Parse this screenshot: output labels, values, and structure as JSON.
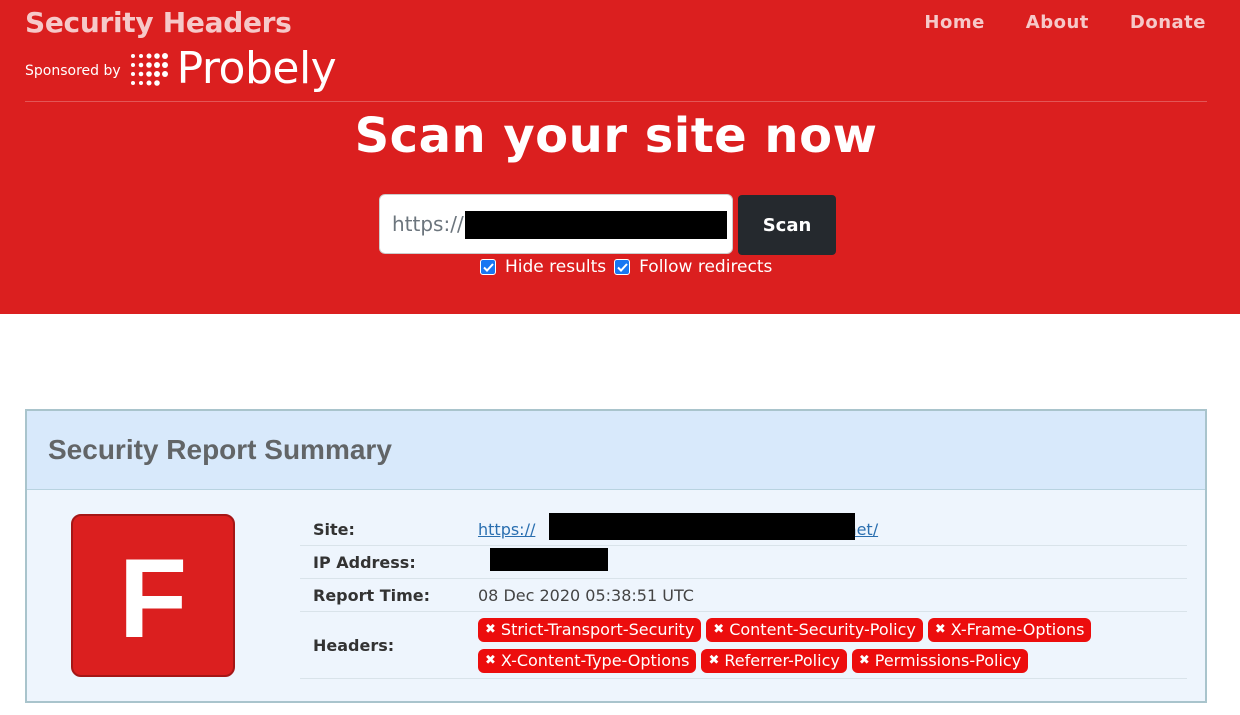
{
  "header": {
    "brand_title": "Security Headers",
    "sponsor_label": "Sponsored by",
    "sponsor_name": "Probely",
    "nav": [
      "Home",
      "About",
      "Donate"
    ],
    "heading": "Scan your site now",
    "url_placeholder": "https://",
    "scan_label": "Scan",
    "options": [
      {
        "label": "Hide results",
        "checked": true
      },
      {
        "label": "Follow redirects",
        "checked": true
      }
    ]
  },
  "report": {
    "title": "Security Report Summary",
    "grade": "F",
    "site_label": "Site:",
    "site_prefix": "https://",
    "site_suffix": ".net/",
    "ip_label": "IP Address:",
    "time_label": "Report Time:",
    "time_value": "08 Dec 2020 05:38:51 UTC",
    "headers_label": "Headers:",
    "headers_missing": [
      "Strict-Transport-Security",
      "Content-Security-Policy",
      "X-Frame-Options",
      "X-Content-Type-Options",
      "Referrer-Policy",
      "Permissions-Policy"
    ]
  },
  "colors": {
    "brand_red": "#db1f1f",
    "badge_red": "#ec0d0d",
    "scan_button": "#25292e",
    "panel_bg": "#eef5fd"
  }
}
